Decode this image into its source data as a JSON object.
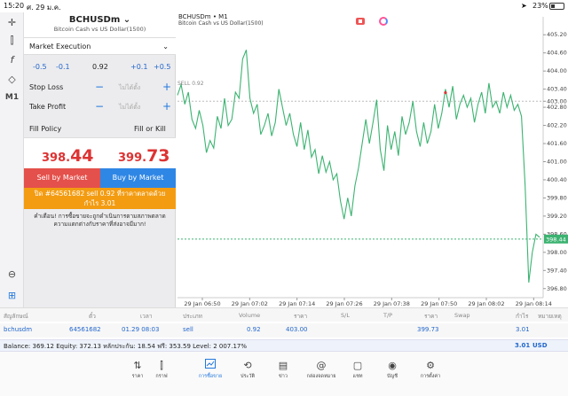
{
  "status": {
    "time": "15:20",
    "date": "ศ. 29 ม.ค.",
    "battery": "23%"
  },
  "toolbar": {
    "timeframe": "M1",
    "icons": [
      "crosshair-icon",
      "candles-icon",
      "function-icon",
      "shapes-icon",
      "timeframe-label",
      "zoom-icon",
      "add-icon"
    ]
  },
  "order": {
    "symbol": "BCHUSDm",
    "description": "Bitcoin Cash vs US Dollar(1500)",
    "execution": "Market Execution",
    "vol_minus_big": "-0.5",
    "vol_minus_small": "-0.1",
    "volume": "0.92",
    "vol_plus_small": "+0.1",
    "vol_plus_big": "+0.5",
    "stop_loss_label": "Stop Loss",
    "stop_loss_value": "ไม่ได้ตั้ง",
    "take_profit_label": "Take Profit",
    "take_profit_value": "ไม่ได้ตั้ง",
    "fill_policy_label": "Fill Policy",
    "fill_policy_value": "Fill or Kill",
    "bid_main": "398.",
    "bid_big": "44",
    "ask_main": "399.",
    "ask_big": "73",
    "sell_button": "Sell by Market",
    "buy_button": "Buy by Market",
    "close_line1": "ปิด #64561682 sell 0.92 ที่ราคาตลาดด้วย",
    "close_line2": "กำไร 3.01",
    "warning_line1": "คำเตือน! การซื้อขายจะถูกดำเนินการตามสภาพตลาด",
    "warning_line2": "ความแตกต่างกับราคาที่ส่งอาจมีมาก!"
  },
  "chart": {
    "title": "BCHUSDm • M1",
    "subtitle": "Bitcoin Cash vs US Dollar(1500)",
    "sell_label": "SELL 0.92",
    "current_price_tag": "398.44",
    "line_color": "#3cb371",
    "price_tag_color": "#3cb371"
  },
  "chart_data": {
    "type": "line",
    "x_tick_labels": [
      "29 Jan 06:50",
      "29 Jan 07:02",
      "29 Jan 07:14",
      "29 Jan 07:26",
      "29 Jan 07:38",
      "29 Jan 07:50",
      "29 Jan 08:02",
      "29 Jan 08:14"
    ],
    "y_tick_labels": [
      "405.20",
      "404.60",
      "404.00",
      "403.40",
      "403.00",
      "402.80",
      "402.20",
      "401.60",
      "401.00",
      "400.40",
      "399.80",
      "399.20",
      "398.60",
      "398.00",
      "397.40",
      "396.80"
    ],
    "ylim": [
      396.5,
      405.5
    ],
    "sell_level": 403.0,
    "current_price": 398.44,
    "values": [
      403.2,
      403.55,
      402.9,
      403.3,
      402.4,
      402.1,
      402.7,
      402.2,
      401.3,
      401.7,
      401.45,
      402.5,
      402.1,
      403.1,
      402.2,
      402.4,
      403.3,
      403.1,
      404.4,
      404.7,
      403.1,
      402.6,
      402.9,
      401.9,
      402.2,
      402.6,
      401.85,
      402.3,
      403.4,
      402.8,
      402.2,
      402.6,
      401.9,
      401.5,
      402.3,
      401.4,
      402.05,
      401.15,
      401.4,
      400.6,
      401.2,
      400.65,
      401.0,
      400.4,
      400.6,
      399.7,
      399.1,
      399.8,
      399.2,
      400.2,
      400.8,
      401.6,
      402.4,
      401.6,
      402.3,
      403.05,
      401.4,
      400.7,
      402.2,
      401.4,
      402.0,
      401.2,
      402.5,
      401.9,
      402.3,
      403.0,
      402.0,
      401.5,
      402.3,
      401.6,
      402.0,
      402.9,
      402.1,
      402.6,
      403.4,
      402.8,
      403.5,
      402.4,
      402.9,
      403.2,
      402.8,
      403.1,
      402.3,
      402.9,
      403.3,
      402.6,
      403.6,
      402.8,
      403.0,
      402.6,
      403.3,
      402.8,
      403.2,
      402.7,
      402.9,
      402.5,
      400.2,
      397.0,
      398.0,
      398.6,
      398.5
    ]
  },
  "table": {
    "headers": [
      "สัญลักษณ์",
      "ตั๋ว",
      "เวลา",
      "ประเภท",
      "Volume",
      "ราคา",
      "S/L",
      "T/P",
      "ราคา",
      "Swap",
      "กำไร",
      "หมายเหตุ"
    ],
    "row": {
      "symbol": "bchusdm",
      "ticket": "64561682",
      "time": "01.29 08:03",
      "type": "sell",
      "volume": "0.92",
      "open_price": "403.00",
      "current_price": "399.73",
      "profit": "3.01"
    }
  },
  "balance": {
    "text": "Balance: 369.12  Equity: 372.13  หลักประกัน: 18.54  ฟรี: 353.59  Level: 2 007.17%",
    "profit": "3.01",
    "currency": "USD"
  },
  "nav": [
    {
      "name": "quotes",
      "label": "ราคา",
      "icon": "⇅"
    },
    {
      "name": "chart",
      "label": "กราฟ",
      "icon": "⫿"
    },
    {
      "name": "trade",
      "label": "การซื้อขาย",
      "icon": "📈"
    },
    {
      "name": "history",
      "label": "ประวัติ",
      "icon": "⟲"
    },
    {
      "name": "news",
      "label": "ข่าว",
      "icon": "▤"
    },
    {
      "name": "mail",
      "label": "กล่องจดหมาย",
      "icon": "@"
    },
    {
      "name": "chat",
      "label": "แชท",
      "icon": "▢"
    },
    {
      "name": "account",
      "label": "บัญชี",
      "icon": "◉"
    },
    {
      "name": "settings",
      "label": "การตั้งค่า",
      "icon": "⚙"
    }
  ]
}
